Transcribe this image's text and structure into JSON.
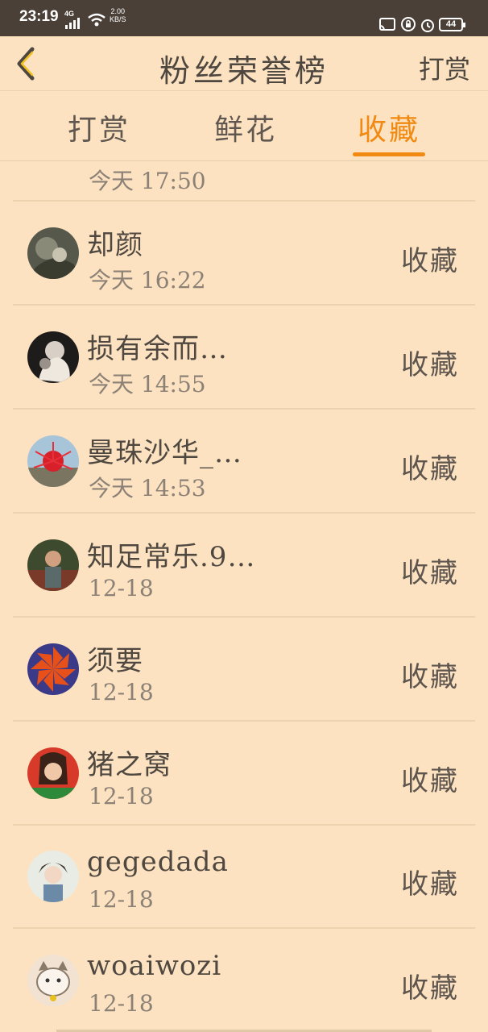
{
  "status_bar": {
    "time": "23:19",
    "network": "4G",
    "speed_value": "2.00",
    "speed_unit": "KB/S",
    "battery": "44"
  },
  "header": {
    "title": "粉丝荣誉榜",
    "action": "打赏",
    "back_icon": "chevron-left-icon"
  },
  "tabs": [
    {
      "label": "打赏",
      "active": false
    },
    {
      "label": "鲜花",
      "active": false
    },
    {
      "label": "收藏",
      "active": true
    }
  ],
  "accent_color": "#f08a12",
  "background_color": "#fce2c0",
  "list": {
    "items": [
      {
        "name": "",
        "time": "今天 17:50",
        "action": ""
      },
      {
        "name": "却颜",
        "time": "今天 16:22",
        "action": "收藏"
      },
      {
        "name": "损有余而…",
        "time": "今天 14:55",
        "action": "收藏"
      },
      {
        "name": "曼珠沙华_…",
        "time": "今天 14:53",
        "action": "收藏"
      },
      {
        "name": "知足常乐.9…",
        "time": "12-18",
        "action": "收藏"
      },
      {
        "name": "须要",
        "time": "12-18",
        "action": "收藏"
      },
      {
        "name": "猪之窝",
        "time": "12-18",
        "action": "收藏"
      },
      {
        "name": "gegedada",
        "time": "12-18",
        "action": "收藏"
      },
      {
        "name": "woaiwozi",
        "time": "12-18",
        "action": "收藏"
      }
    ]
  }
}
